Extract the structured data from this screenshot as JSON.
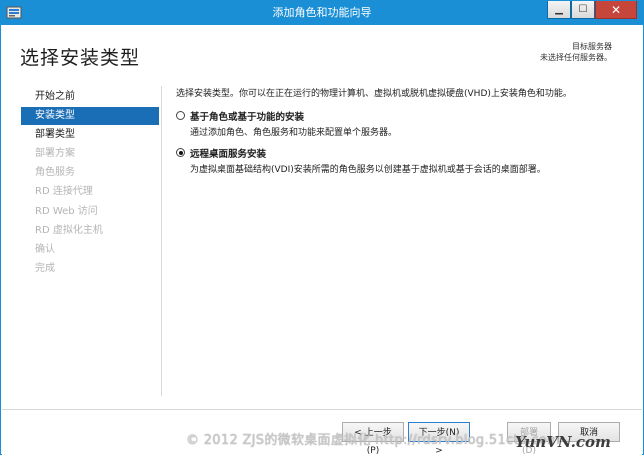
{
  "window": {
    "title": "添加角色和功能向导",
    "minimize_glyph": "▁",
    "maximize_glyph": "☐",
    "close_glyph": "✕"
  },
  "header": {
    "page_title": "选择安装类型",
    "destination_label": "目标服务器",
    "destination_value": "未选择任何服务器。"
  },
  "sidebar": {
    "items": [
      {
        "label": "开始之前",
        "state": "normal"
      },
      {
        "label": "安装类型",
        "state": "active"
      },
      {
        "label": "部署类型",
        "state": "normal"
      },
      {
        "label": "部署方案",
        "state": "disabled"
      },
      {
        "label": "角色服务",
        "state": "disabled"
      },
      {
        "label": "RD 连接代理",
        "state": "disabled"
      },
      {
        "label": "RD Web 访问",
        "state": "disabled"
      },
      {
        "label": "RD 虚拟化主机",
        "state": "disabled"
      },
      {
        "label": "确认",
        "state": "disabled"
      },
      {
        "label": "完成",
        "state": "disabled"
      }
    ]
  },
  "content": {
    "intro": "选择安装类型。你可以在正在运行的物理计算机、虚拟机或脱机虚拟硬盘(VHD)上安装角色和功能。",
    "options": [
      {
        "label": "基于角色或基于功能的安装",
        "description": "通过添加角色、角色服务和功能来配置单个服务器。",
        "checked": false
      },
      {
        "label": "远程桌面服务安装",
        "description": "为虚拟桌面基础结构(VDI)安装所需的角色服务以创建基于虚拟机或基于会话的桌面部署。",
        "checked": true
      }
    ]
  },
  "footer": {
    "back": "< 上一步(P)",
    "next": "下一步(N) >",
    "install": "部署(D)",
    "cancel": "取消"
  },
  "watermark": {
    "text": "© 2012 ZJS的微软桌面虚拟化 http://rdsrv.blog.51cto.com",
    "brand": "YunVN.com"
  },
  "colors": {
    "titlebar": "#1a8fd6",
    "active_nav": "#1a6eb5",
    "disabled_text": "#b5b5b5"
  }
}
